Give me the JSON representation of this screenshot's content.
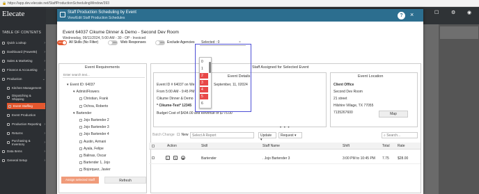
{
  "browser": {
    "url": "https://app.dev.elecate.net/StaffProductionSchedulingWindow/393"
  },
  "app": {
    "logo": "Elecate",
    "toc_title": "TABLE OF CONTENTS",
    "sidebar": [
      {
        "label": "Quick Lookup",
        "chev": "›"
      },
      {
        "label": "Dashboard (PowerBI)",
        "chev": "›"
      },
      {
        "label": "Sales & Marketing",
        "chev": "›"
      },
      {
        "label": "Finance & Accounting",
        "chev": "›"
      },
      {
        "label": "Production",
        "chev": "⌄"
      },
      {
        "label": "Kitchen Management",
        "chev": ""
      },
      {
        "label": "Dispatching & Shipping",
        "chev": ""
      },
      {
        "label": "Event Staffing",
        "chev": "›"
      },
      {
        "label": "Event Production",
        "chev": ""
      },
      {
        "label": "Production Reporting",
        "chev": "›"
      },
      {
        "label": "Returns",
        "chev": "›"
      },
      {
        "label": "Purchasing & Inventory",
        "chev": "›"
      },
      {
        "label": "Data Items",
        "chev": "›"
      },
      {
        "label": "General Setup",
        "chev": "›"
      }
    ]
  },
  "modal": {
    "title": "Staff Production Scheduling by Event",
    "subtitle": "View/Edit Staff Production Schedules",
    "help": "?",
    "close": "×",
    "event_title": "Event 64037 Cikume Dinner & Demo - Second Dev Room",
    "event_sub": "Wednesday, 09/11/2024, 5:00 AM - 30 - OP - Invoiced",
    "filters": {
      "all_skills_on": "ON",
      "all_skills_label": "All Skills (No Filter)",
      "web_label": "Web Responses",
      "off": "OFF",
      "exclude_label": "Exclude Agencies",
      "selected_text": "Selected : 0",
      "clear": "×"
    },
    "dropdown": {
      "items": [
        "0",
        "1",
        "2",
        "3",
        "4",
        "5",
        "6"
      ],
      "highlighted": [
        2,
        3,
        4,
        5
      ]
    },
    "requirements": {
      "title": "Event Requirements",
      "search_placeholder": "Enter search text...",
      "tree": [
        {
          "label": "Event ID: 64037",
          "level": 0,
          "checkbox": false,
          "toggle": "▾"
        },
        {
          "label": "Admin/Flowers",
          "level": 1,
          "checkbox": false,
          "toggle": "▾"
        },
        {
          "label": "Christian, Frank",
          "level": 2,
          "checkbox": true,
          "toggle": ""
        },
        {
          "label": "Ochoa, Roberto",
          "level": 2,
          "checkbox": true,
          "toggle": ""
        },
        {
          "label": "Bartender",
          "level": 1,
          "checkbox": false,
          "toggle": "▾"
        },
        {
          "label": "Jojo Bartender 2",
          "level": 2,
          "checkbox": true,
          "toggle": ""
        },
        {
          "label": "Jojo Bartender 3",
          "level": 2,
          "checkbox": true,
          "toggle": ""
        },
        {
          "label": "Jojo Bartender 4",
          "level": 2,
          "checkbox": true,
          "toggle": ""
        },
        {
          "label": "Austin, Armani",
          "level": 2,
          "checkbox": true,
          "toggle": ""
        },
        {
          "label": "Ayala, Felipe",
          "level": 2,
          "checkbox": true,
          "toggle": ""
        },
        {
          "label": "Balinas, Oscar",
          "level": 2,
          "checkbox": true,
          "toggle": ""
        },
        {
          "label": "Bartender 1, Jojo",
          "level": 2,
          "checkbox": true,
          "toggle": ""
        },
        {
          "label": "Bojorquez, Javier",
          "level": 2,
          "checkbox": true,
          "toggle": ""
        }
      ],
      "assign_btn": "Assign selected Staff",
      "refresh_btn": "Refresh"
    },
    "assigned_title": "Staff Assigned for Selected Event",
    "details": {
      "title": "Event Details",
      "lines": [
        "Event ID # 64037 on We",
        "From 5:00 AM - 9:45 PM",
        "Cikume Dinner & Demo",
        "* Cikume-Test* 12345",
        "Budget Cost of $434.00 and Revenue of $775.00"
      ],
      "date_suffix": "September, 11, 02024"
    },
    "location": {
      "title": "Event Location",
      "lines": [
        "Client Office",
        "Second Dev Room",
        "21 street",
        "Hilshire Village, TX 77055",
        "7135267600"
      ],
      "map_btn": "Map"
    },
    "toolbar": {
      "batch": "Batch Change",
      "new": "New",
      "report_placeholder": "Select A Report",
      "update": "Update",
      "request": "Request",
      "search_placeholder": "Search..."
    },
    "grid": {
      "headers": {
        "action": "Action",
        "skill": "Skill",
        "staff": "Staff Name",
        "shift": "Shift",
        "total": "Total",
        "rate": "Rate"
      },
      "rows": [
        {
          "skill": "Bartender",
          "staff": ". Jojo Bartender 3",
          "shift": "3:00 PM to 10:45 PM",
          "total": "7.75",
          "rate": "$28.00"
        }
      ]
    }
  }
}
